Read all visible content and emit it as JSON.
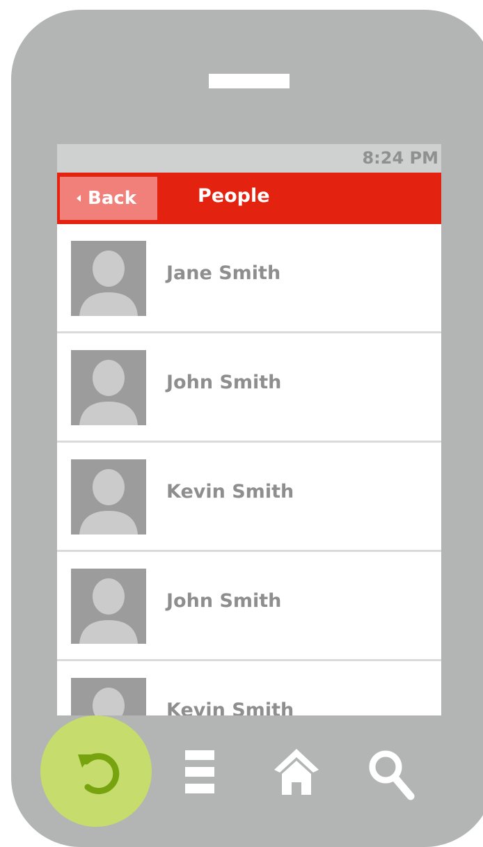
{
  "status_bar": {
    "time": "8:24 PM"
  },
  "header": {
    "back_label": "Back",
    "title": "People"
  },
  "people": [
    {
      "name": "Jane Smith"
    },
    {
      "name": "John Smith"
    },
    {
      "name": "Kevin Smith"
    },
    {
      "name": "John Smith"
    },
    {
      "name": "Kevin Smith"
    }
  ],
  "bottom_nav": {
    "icons": [
      "refresh-icon",
      "menu-icon",
      "home-icon",
      "search-icon"
    ]
  },
  "colors": {
    "device": "#b2b5b4",
    "header": "#e3230f",
    "back_button": "#f1807b",
    "refresh_button": "#c6dd6d",
    "avatar": "#9c9c9c",
    "text_secondary": "#8e8e8e"
  }
}
